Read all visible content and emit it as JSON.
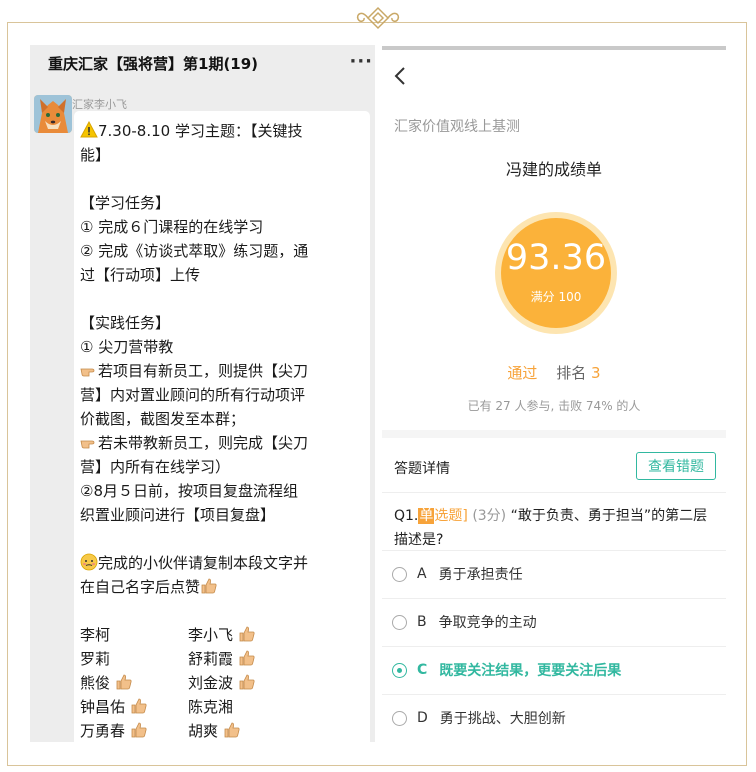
{
  "chat": {
    "group_title": "重庆汇家【强将营】第1期(19)",
    "more_icon": "more-dots-icon",
    "sender": "汇家李小飞",
    "message_lines": [
      "7.30-8.10 学习主题：【关键技",
      "能】",
      "",
      "【学习任务】",
      "① 完成６门课程的在线学习",
      "② 完成《访谈式萃取》练习题，通",
      "过【行动项】上传",
      "",
      "【实践任务】",
      "① 尖刀营带教",
      "若项目有新员工，则提供【尖刀",
      "营】内对置业顾问的所有行动项评",
      "价截图，截图发至本群；",
      "若未带教新员工，则完成【尖刀",
      "营】内所有在线学习）",
      "②8月５日前，按项目复盘流程组",
      "织置业顾问进行【项目复盘】",
      "",
      "完成的小伙伴请复制本段文字并",
      "在自己名字后点赞"
    ],
    "names": [
      {
        "name": "李柯",
        "liked": false
      },
      {
        "name": "李小飞",
        "liked": true
      },
      {
        "name": "罗莉",
        "liked": false
      },
      {
        "name": "舒莉霞",
        "liked": true
      },
      {
        "name": "熊俊",
        "liked": true
      },
      {
        "name": "刘金波",
        "liked": true
      },
      {
        "name": "钟昌佑",
        "liked": true
      },
      {
        "name": "陈克湘",
        "liked": false
      },
      {
        "name": "万勇春",
        "liked": true
      },
      {
        "name": "胡爽",
        "liked": true
      }
    ]
  },
  "app": {
    "back_icon": "back-chevron-icon",
    "title": "汇家价值观线上基测",
    "report_title": "冯建的成绩单",
    "score": "93.36",
    "full_score": "满分 100",
    "pass_label": "通过",
    "rank_label": "排名",
    "rank": "3",
    "stats": "已有 27 人参与, 击败 74% 的人",
    "detail_title": "答题详情",
    "wrong_button": "查看错题",
    "question": {
      "number": "Q1.",
      "type_tag": "单",
      "type_rest": "选题]",
      "score": "(3分)",
      "text": "“敢于负责、勇于担当”的第二层描述是?"
    },
    "options": [
      {
        "letter": "A",
        "text": "勇于承担责任",
        "selected": false
      },
      {
        "letter": "B",
        "text": "争取竞争的主动",
        "selected": false
      },
      {
        "letter": "C",
        "text": "既要关注结果，更要关注后果",
        "selected": true
      },
      {
        "letter": "D",
        "text": "勇于挑战、大胆创新",
        "selected": false
      }
    ],
    "colors": {
      "accent": "#f7a33a",
      "teal": "#32b8a0",
      "score_bg": "#fbb23a"
    }
  }
}
